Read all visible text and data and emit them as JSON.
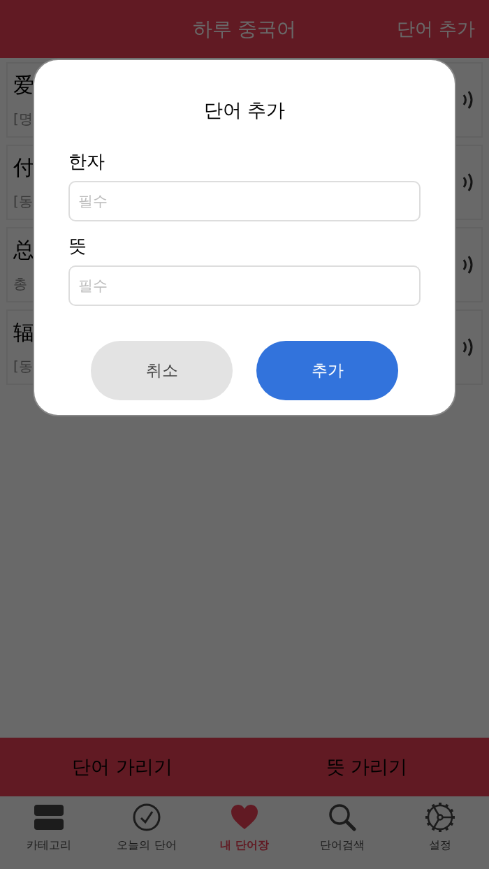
{
  "header": {
    "title": "하루 중국어",
    "action": "단어 추가"
  },
  "words": [
    {
      "hanzi": "爱",
      "meaning": "[명"
    },
    {
      "hanzi": "付",
      "meaning": "[동"
    },
    {
      "hanzi": "总",
      "meaning": "총"
    },
    {
      "hanzi": "辐",
      "meaning": "[동"
    }
  ],
  "bottom_buttons": [
    "단어 가리기",
    "뜻 가리기"
  ],
  "tabs": [
    {
      "label": "카테고리",
      "selected": false
    },
    {
      "label": "오늘의 단어",
      "selected": false
    },
    {
      "label": "내 단어장",
      "selected": true
    },
    {
      "label": "단어검색",
      "selected": false
    },
    {
      "label": "설정",
      "selected": false
    }
  ],
  "dialog": {
    "title": "단어 추가",
    "fields": [
      {
        "label": "한자",
        "placeholder": "필수"
      },
      {
        "label": "뜻",
        "placeholder": "필수"
      }
    ],
    "cancel": "취소",
    "confirm": "추가"
  }
}
